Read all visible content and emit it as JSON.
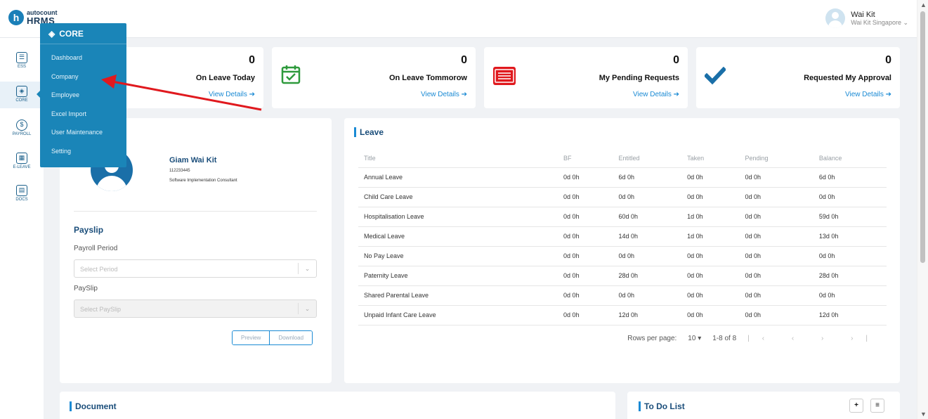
{
  "brand": {
    "line1": "autocount",
    "line2": "HRMS",
    "mark": "h"
  },
  "user": {
    "name": "Wai Kit",
    "company": "Wai Kit Singapore ⌄"
  },
  "leftnav": [
    {
      "label": "ESS",
      "icon": "ess-icon"
    },
    {
      "label": "CORE",
      "icon": "core-icon"
    },
    {
      "label": "PAYROLL",
      "icon": "payroll-icon"
    },
    {
      "label": "E-LEAVE",
      "icon": "calendar-icon"
    },
    {
      "label": "DOCS",
      "icon": "docs-icon"
    }
  ],
  "core_menu": {
    "title": "CORE",
    "items": [
      "Dashboard",
      "Company",
      "Employee",
      "Excel Import",
      "User Maintenance",
      "Setting"
    ]
  },
  "stats": [
    {
      "value": "0",
      "title": "On Leave Today",
      "link": "View Details ➔"
    },
    {
      "value": "0",
      "title": "On Leave Tommorow",
      "link": "View Details ➔"
    },
    {
      "value": "0",
      "title": "My Pending Requests",
      "link": "View Details ➔"
    },
    {
      "value": "0",
      "title": "Requested My Approval",
      "link": "View Details ➔"
    }
  ],
  "profile": {
    "name": "Giam Wai Kit",
    "id": "112233445",
    "job": "Software Implementation Consultant"
  },
  "payslip": {
    "title": "Payslip",
    "period_label": "Payroll Period",
    "period_placeholder": "Select Period",
    "payslip_label": "PaySlip",
    "payslip_placeholder": "Select PaySlip",
    "preview": "Preview",
    "download": "Download"
  },
  "leave": {
    "title": "Leave",
    "headers": [
      "Title",
      "BF",
      "Entitled",
      "Taken",
      "Pending",
      "Balance"
    ],
    "rows": [
      [
        "Annual Leave",
        "0d 0h",
        "6d 0h",
        "0d 0h",
        "0d 0h",
        "6d 0h"
      ],
      [
        "Child Care Leave",
        "0d 0h",
        "0d 0h",
        "0d 0h",
        "0d 0h",
        "0d 0h"
      ],
      [
        "Hospitalisation Leave",
        "0d 0h",
        "60d 0h",
        "1d 0h",
        "0d 0h",
        "59d 0h"
      ],
      [
        "Medical Leave",
        "0d 0h",
        "14d 0h",
        "1d 0h",
        "0d 0h",
        "13d 0h"
      ],
      [
        "No Pay Leave",
        "0d 0h",
        "0d 0h",
        "0d 0h",
        "0d 0h",
        "0d 0h"
      ],
      [
        "Paternity Leave",
        "0d 0h",
        "28d 0h",
        "0d 0h",
        "0d 0h",
        "28d 0h"
      ],
      [
        "Shared Parental Leave",
        "0d 0h",
        "0d 0h",
        "0d 0h",
        "0d 0h",
        "0d 0h"
      ],
      [
        "Unpaid Infant Care Leave",
        "0d 0h",
        "12d 0h",
        "0d 0h",
        "0d 0h",
        "12d 0h"
      ]
    ],
    "rows_per_page_label": "Rows per page:",
    "rows_per_page": "10 ▾",
    "range": "1-8 of 8",
    "pager_nav": "|‹ ‹ › ›|"
  },
  "document": {
    "title": "Document"
  },
  "todo": {
    "title": "To Do List",
    "add": "+",
    "list": "≡"
  },
  "colors": {
    "accent": "#1a8ad4",
    "menu": "#1a85b8",
    "arrow": "#e0191e"
  }
}
